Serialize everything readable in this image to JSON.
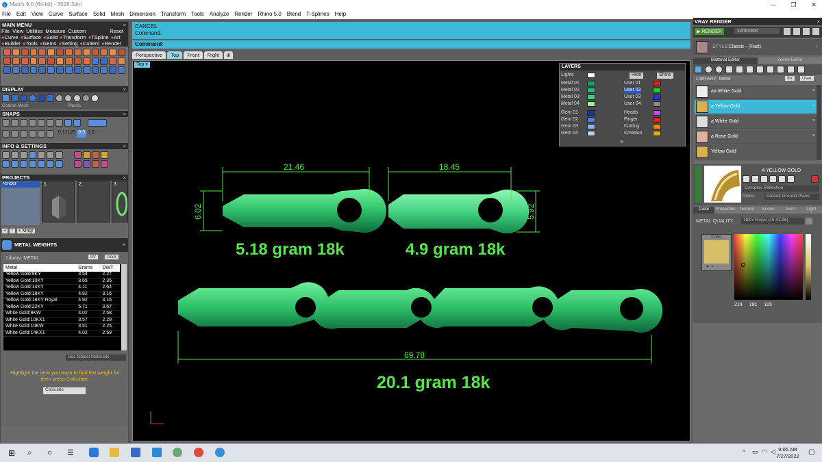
{
  "window": {
    "title": "Matrix 9.0 (64-bit) - 3628.3dm"
  },
  "menu": [
    "File",
    "Edit",
    "View",
    "Curve",
    "Surface",
    "Solid",
    "Mesh",
    "Dimension",
    "Transform",
    "Tools",
    "Analyze",
    "Render",
    "Rhino 5.0",
    "Blend",
    "T-Splines",
    "Help"
  ],
  "main_menu": {
    "header": "MAIN MENU",
    "row1": [
      "File",
      "View",
      "Utilities",
      "Measure",
      "Custom",
      "Reset"
    ],
    "row2": [
      "Curve",
      "Surface",
      "Solid",
      "Transform",
      "TSpline",
      "Art"
    ],
    "row3": [
      "Builder",
      "Tools",
      "Gems",
      "Setting",
      "Cutters",
      "Render"
    ]
  },
  "display": {
    "header": "DISPLAY",
    "mesh": "Coarse Mesh",
    "style": "Plastic"
  },
  "snaps": {
    "header": "SNAPS",
    "values": [
      "0.1",
      "0.25",
      "0.5",
      "1.0"
    ]
  },
  "info": {
    "header": "INFO & SETTINGS"
  },
  "projects": {
    "header": "PROJECTS",
    "item": "render",
    "slots": [
      "1",
      "2",
      "3"
    ],
    "btn": "Mngr"
  },
  "metal_weights": {
    "header": "METAL WEIGHTS",
    "library_label": "Library:",
    "library": "METAL",
    "tags": [
      "9V",
      "User"
    ],
    "columns": [
      "Metal",
      "Grams",
      "DWT"
    ],
    "rows": [
      [
        "Yellow Gold:9KY",
        "3.54",
        "2.27"
      ],
      [
        "Yellow Gold:10KY",
        "3.65",
        "2.35"
      ],
      [
        "Yellow Gold:14KY",
        "4.11",
        "2.64"
      ],
      [
        "Yellow Gold:18KY",
        "4.92",
        "3.16"
      ],
      [
        "Yellow Gold:18KY Royal",
        "4.92",
        "3.16"
      ],
      [
        "Yellow Gold:22KY",
        "5.71",
        "3.67"
      ],
      [
        "White Gold:9KW",
        "4.02",
        "2.58"
      ],
      [
        "White Gold:10KX1",
        "3.57",
        "2.29"
      ],
      [
        "White Gold:10KW",
        "3.51",
        "2.25"
      ],
      [
        "White Gold:14KX1",
        "4.02",
        "2.59"
      ]
    ],
    "use_obj": "Use Object Materials",
    "hint": "Highlight the item you want to find the weight for then press Calculate.",
    "calc": "Calculate"
  },
  "command": {
    "cancel": "CANCEL",
    "line1": "Command:",
    "line2": "Command:"
  },
  "tabs": [
    "Perspective",
    "Top",
    "Front",
    "Right"
  ],
  "active_tab": "Top",
  "viewport_label": "Top",
  "layers": {
    "header": "LAYERS",
    "lights": "Lights",
    "hide": "Hide",
    "show": "Show",
    "left": [
      {
        "n": "Metal 01",
        "c": "#16a06e"
      },
      {
        "n": "Metal 02",
        "c": "#1fbf76"
      },
      {
        "n": "Metal 03",
        "c": "#36d17a"
      },
      {
        "n": "Metal 04",
        "c": "#9ff09a"
      }
    ],
    "right": [
      {
        "n": "User 01",
        "c": "#e02020"
      },
      {
        "n": "User 02",
        "c": "#22cc22"
      },
      {
        "n": "User 03",
        "c": "#2233ee"
      },
      {
        "n": "User 04",
        "c": "#888888"
      }
    ],
    "left2": [
      {
        "n": "Gem 01",
        "c": "#103a9a"
      },
      {
        "n": "Gem 02",
        "c": "#5a7ad8"
      },
      {
        "n": "Gem 03",
        "c": "#8ab8ee"
      },
      {
        "n": "Gem 04",
        "c": "#b8d0f0"
      }
    ],
    "right2": [
      {
        "n": "Heads",
        "c": "#c04ae0"
      },
      {
        "n": "Finger",
        "c": "#e02020"
      },
      {
        "n": "Cutting",
        "c": "#ee8a10"
      },
      {
        "n": "Creation",
        "c": "#eeaa10"
      }
    ]
  },
  "annotations": {
    "w1": "21.46",
    "h1": "6.02",
    "w2": "18.45",
    "h2": "5.92",
    "total": "69.78",
    "weight1": "5.18 gram 18k",
    "weight2": "4.9 gram 18k",
    "weight3": "20.1 gram 18k"
  },
  "vray": {
    "header": "VRAY RENDER",
    "render_btn": "RENDER",
    "resolution": "1200x900",
    "style_label": "STYLE:",
    "style": "Classic - (Fast)",
    "tabs": [
      "Material Editor",
      "Scene Editor"
    ],
    "library_label": "LIBRARY:",
    "library": "Metal",
    "tags": [
      "9V",
      "User"
    ],
    "materials": [
      "aa White Gold",
      "a Yellow Gold",
      "a White Gold",
      "a Rose Gold",
      "Yellow Gold"
    ],
    "selected_material": "A YELLOW GOLD",
    "reflection": "Complex Reflection",
    "alpha": "Alpha",
    "ground": "Default-Ground Plane",
    "subtabs": [
      "Color",
      "Properties",
      "Texture",
      "Scene",
      "Toon",
      "Light"
    ],
    "metal_quality_label": "METAL QUALITY:",
    "metal_quality": "18KY Royal (15:41.96)",
    "color_label": "Color",
    "rgb": [
      "214",
      "191",
      "105"
    ],
    "swatch": "#d6bf69"
  },
  "taskbar": {
    "time": "9:05 AM",
    "date": "7/27/2022"
  },
  "colors": {
    "accent_green": "#55e64a",
    "cmd_blue": "#3cb8d9"
  }
}
